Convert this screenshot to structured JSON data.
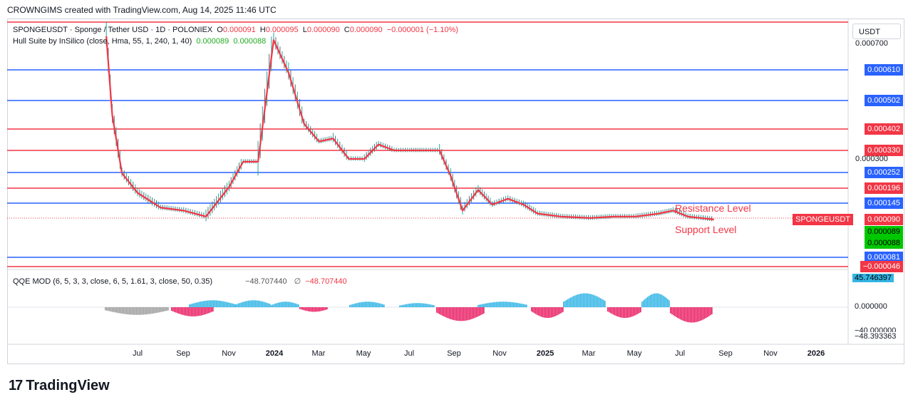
{
  "header": {
    "text": "CROWNGIMS created with TradingView.com, Aug 14, 2025 11:46 UTC"
  },
  "legend": {
    "symbol": "SPONGEUSDT · Sponge / Tether USD · 1D · POLONIEX",
    "o_label": "O",
    "o_value": "0.000091",
    "h_label": "H",
    "h_value": "0.000095",
    "l_label": "L",
    "l_value": "0.000090",
    "c_label": "C",
    "c_value": "0.000090",
    "change": "−0.000001 (−1.10%)",
    "hull": "Hull Suite by InSilico (close, Hma, 55, 1, 240, 1, 40)",
    "hull_v1": "0.000089",
    "hull_v2": "0.000088"
  },
  "qqe": {
    "label": "QQE MOD (6, 5, 3, 3, close, 6, 5, 1.61, 3, close, 50, 0.35)",
    "v1": "−48.707440",
    "v2": "∅",
    "v3": "−48.707440"
  },
  "currency_button": "USDT",
  "annotations": {
    "resistance": "Resistance Level",
    "support": "Support Level"
  },
  "colors": {
    "red": "#f23645",
    "blue": "#2962ff",
    "green": "#00c800",
    "teal": "#33b5e5",
    "pink": "#e91e63",
    "gray": "#9e9e9e"
  },
  "chart_data": {
    "type": "line",
    "title": "SPONGEUSDT · Sponge / Tether USD · 1D · POLONIEX",
    "y_scale": "price (USDT)",
    "ylim": [
      4.6e-05,
      0.00074
    ],
    "horizontal_levels": [
      {
        "value": 0.00061,
        "color": "blue",
        "label": "0.000610"
      },
      {
        "value": 0.000502,
        "color": "blue",
        "label": "0.000502"
      },
      {
        "value": 0.000402,
        "color": "red",
        "label": "0.000402"
      },
      {
        "value": 0.00033,
        "color": "red",
        "label": "0.000330"
      },
      {
        "value": 0.000252,
        "color": "blue",
        "label": "0.000252"
      },
      {
        "value": 0.000196,
        "color": "red",
        "label": "0.000196"
      },
      {
        "value": 0.000145,
        "color": "blue",
        "label": "0.000145"
      },
      {
        "value": 8.1e-05,
        "color": "blue",
        "label": "0.000081"
      },
      {
        "value": -4.6e-05,
        "color": "red",
        "label": "−0.000046"
      }
    ],
    "price_tags": [
      {
        "label": "SPONGEUSDT",
        "value": "0.000090",
        "color": "#f23645"
      },
      {
        "value": "0.000089",
        "color": "#00c800"
      },
      {
        "value": "0.000088",
        "color": "#00c800"
      }
    ],
    "axis_ticks_partial": [
      "0.000700",
      "0.000300",
      "0.000090"
    ],
    "x_ticks": [
      "Jul",
      "Sep",
      "Nov",
      "2024",
      "Mar",
      "May",
      "Jul",
      "Sep",
      "Nov",
      "2025",
      "Mar",
      "May",
      "Jul",
      "Sep",
      "Nov",
      "2026"
    ],
    "price_series": {
      "name": "Price (approx close)",
      "x": [
        "2023-05-20",
        "2023-05-28",
        "2023-06-10",
        "2023-07-01",
        "2023-08-01",
        "2023-09-01",
        "2023-10-01",
        "2023-11-01",
        "2023-11-20",
        "2023-12-10",
        "2023-12-31",
        "2024-01-20",
        "2024-02-10",
        "2024-03-01",
        "2024-03-20",
        "2024-04-10",
        "2024-05-01",
        "2024-05-20",
        "2024-06-10",
        "2024-07-01",
        "2024-07-20",
        "2024-08-10",
        "2024-08-25",
        "2024-09-10",
        "2024-10-01",
        "2024-10-20",
        "2024-11-10",
        "2024-12-01",
        "2024-12-20",
        "2025-01-20",
        "2025-03-01",
        "2025-04-01",
        "2025-05-01",
        "2025-06-01",
        "2025-06-20",
        "2025-07-10",
        "2025-08-14"
      ],
      "values": [
        0.0007,
        0.00045,
        0.00025,
        0.00018,
        0.00013,
        0.00012,
        0.0001,
        0.0002,
        0.00029,
        0.00029,
        0.00069,
        0.0006,
        0.00042,
        0.00036,
        0.00037,
        0.0003,
        0.0003,
        0.00035,
        0.00033,
        0.00033,
        0.00033,
        0.00033,
        0.00024,
        0.00012,
        0.00019,
        0.00014,
        0.00016,
        0.00014,
        0.00011,
        0.0001,
        9.5e-05,
        0.0001,
        0.0001,
        0.00011,
        0.00012,
        0.0001,
        9e-05
      ]
    },
    "qqe_series": {
      "name": "QQE MOD",
      "ylim": [
        -48.393363,
        45.746397
      ],
      "axis_labels": [
        "45.746397",
        "0.000000",
        "−40.000000",
        "−48.393363"
      ]
    }
  }
}
